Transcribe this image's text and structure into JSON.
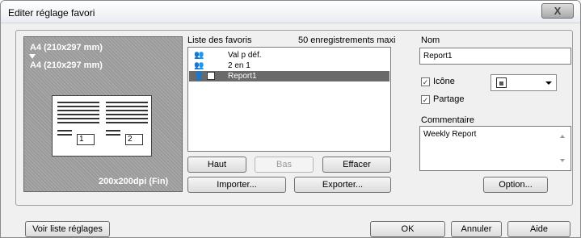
{
  "window": {
    "title": "Editer réglage favori",
    "close_label": "X"
  },
  "preview": {
    "paper_top": "A4 (210x297 mm)",
    "paper_bottom": "A4 (210x297 mm)",
    "resolution": "200x200dpi (Fin)",
    "page_numbers": [
      "1",
      "2"
    ]
  },
  "favorites": {
    "header": "Liste des favoris",
    "count_label": "50 enregistrements maxi",
    "items": [
      {
        "label": "Val p déf.",
        "selected": false
      },
      {
        "label": "2 en 1",
        "selected": false
      },
      {
        "label": "Report1",
        "selected": true
      }
    ],
    "buttons": {
      "up": "Haut",
      "down": "Bas",
      "delete": "Effacer",
      "import": "Importer...",
      "export": "Exporter..."
    }
  },
  "details": {
    "name_label": "Nom",
    "name_value": "Report1",
    "icon_label": "Icône",
    "icon_checked": true,
    "share_label": "Partage",
    "share_checked": true,
    "comment_label": "Commentaire",
    "comment_value": "Weekly Report",
    "option_button": "Option..."
  },
  "footer": {
    "settings_list": "Voir liste réglages",
    "ok": "OK",
    "cancel": "Annuler",
    "help": "Aide"
  }
}
